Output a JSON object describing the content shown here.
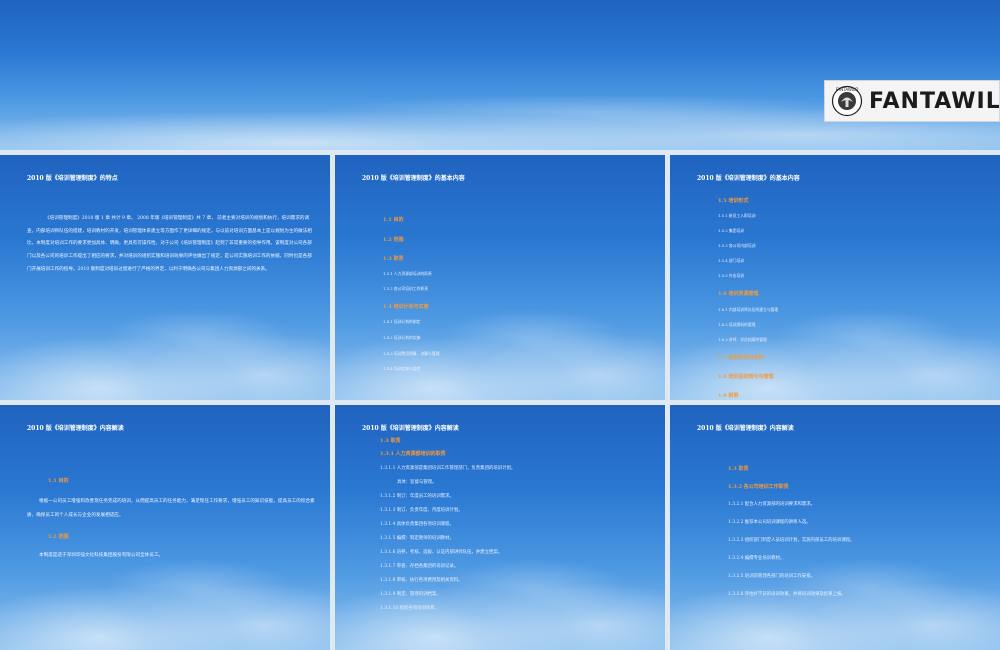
{
  "banner": {
    "logo_text": "FANTAWILD",
    "logo_seal_text": "FANTAWILD"
  },
  "slides": [
    {
      "title": "2010 版《培训管理制度》的特点",
      "paragraph": "《培训管理制度》2010 版 1 章 共计 9 章。 2008 年版《培训管理制度》共 7 章， 前者主要对培训的规划和执行，培训需求的调查，内部培训师队伍的搭建，培训教材的开发，培训管理体系建立等方面作了更详细的规定。与以前对培训方面基本上是以规划为主的做法相比，本制度对培训工作的要求更加具体、明确，更具有可操作性，对于公司《培训管理制度》起到了非常重要的指导作用。该制度对公司各部门以及各公司的培训工作提出了相应的要求，并对培训的组织实施和培训效果的评估做出了规定，是公司实施培训工作的依据，同时也是各部门开展培训工作的指导。2010 版制度对培训过程进行了严格的界定，以利于明确各公司与集团人力资源部之间的关系。"
    },
    {
      "title": "2010 版《培训管理制度》的基本内容",
      "items": [
        {
          "kind": "h",
          "text": "1.1 目的"
        },
        {
          "kind": "h",
          "text": "1.2 范围"
        },
        {
          "kind": "h",
          "text": "1.3 职责"
        },
        {
          "kind": "sub",
          "text": "1.3.1 人力资源部培训的职责"
        },
        {
          "kind": "sub",
          "text": "1.3.2 各公司培训工作职责"
        },
        {
          "kind": "h",
          "text": "1.4 培训计划与实施"
        },
        {
          "kind": "sub",
          "text": "1.4.1 培训计划的制定"
        },
        {
          "kind": "sub",
          "text": "1.4.2 培训计划的实施"
        },
        {
          "kind": "sub",
          "text": "1.4.3 培训费用预算、决算与管理"
        },
        {
          "kind": "sub",
          "text": "1.4.4 培训实施与监控"
        }
      ]
    },
    {
      "title": "2010 版《培训管理制度》的基本内容",
      "items": [
        {
          "kind": "h",
          "text": "1.5 培训形式"
        },
        {
          "kind": "sub",
          "text": "1.5.1 新员工入职培训"
        },
        {
          "kind": "sub",
          "text": "1.5.2 集团培训"
        },
        {
          "kind": "sub",
          "text": "1.5.3 各公司内部培训"
        },
        {
          "kind": "sub",
          "text": "1.5.4 部门培训"
        },
        {
          "kind": "sub",
          "text": "1.5.5 外出培训"
        },
        {
          "kind": "h",
          "text": "1.6 培训资源管理"
        },
        {
          "kind": "sub",
          "text": "1.6.1 内部培训师队伍的建立与管理"
        },
        {
          "kind": "sub",
          "text": "1.6.2 培训资料的管理"
        },
        {
          "kind": "sub",
          "text": "1.6.3 讲师、学员档案的管理"
        },
        {
          "kind": "h",
          "text": "1.7 培训评估与考核"
        },
        {
          "kind": "h",
          "text": "1.8 培训后的转化与管理"
        },
        {
          "kind": "h",
          "text": "1.9 附则"
        }
      ]
    },
    {
      "title": "2010 版《培训管理制度》内容解读",
      "h1": "1.1 目的",
      "p1": "根据一公司员工增强和改善现任务完成的培训，从而提高员工的任务能力，满足现任工作要求，增强员工的知识技能，提高员工的综合素质，确保员工的个人成长与企业的发展相适应。",
      "h2": "1.2 范围",
      "p2": "本制度是适于深圳华强文化科技集团股份有限公司全体员工。"
    },
    {
      "title": "2010 版《培训管理制度》内容解读",
      "h1": "1.3 职责",
      "h2": "1.3.1 人力资源部培训的职责",
      "lines": [
        "1.3.1.1 人力资源部是集团培训工作管理部门，负责集团的培训计划。",
        "具体：监督与管理。",
        "1.3.1.2 制订：年度员工的培训需求。",
        "1.3.1.3 制订、负责年度、月度培训计划。",
        "1.3.1.4 具体负责集团各项培训课程。",
        "1.3.1.5 编撰：制定教师的培训教材。",
        "1.3.1.6 培养、考核、选拔、认证内部讲师队伍，并建立档案。",
        "1.3.1.7 审查、存档各集团的培训记录。",
        "1.3.1.8 审核、执行各项费用及相关资料。",
        "1.3.1.9 制定、管理培训档案。",
        "1.3.1.10 组织各项培训项目。"
      ]
    },
    {
      "title": "2010 版《培训管理制度》内容解读",
      "h1": "1.3 职责",
      "h2": "1.3.2 各公司培训工作职责",
      "lines": [
        "1.3.2.1 配合人力资源部的培训要求和需求。",
        "1.3.2.2 推荐本公司培训课程的讲师人选。",
        "1.3.2.3 组织部门制定人员培训计划，实施内部员工的培训课程。",
        "1.3.2.4 编撰专业培训教材。",
        "1.3.2.5 培训前管理各部门的培训工作安排。",
        "1.3.2.6 评估好学员的培训效果，并将培训效果及结果上报。"
      ]
    }
  ]
}
